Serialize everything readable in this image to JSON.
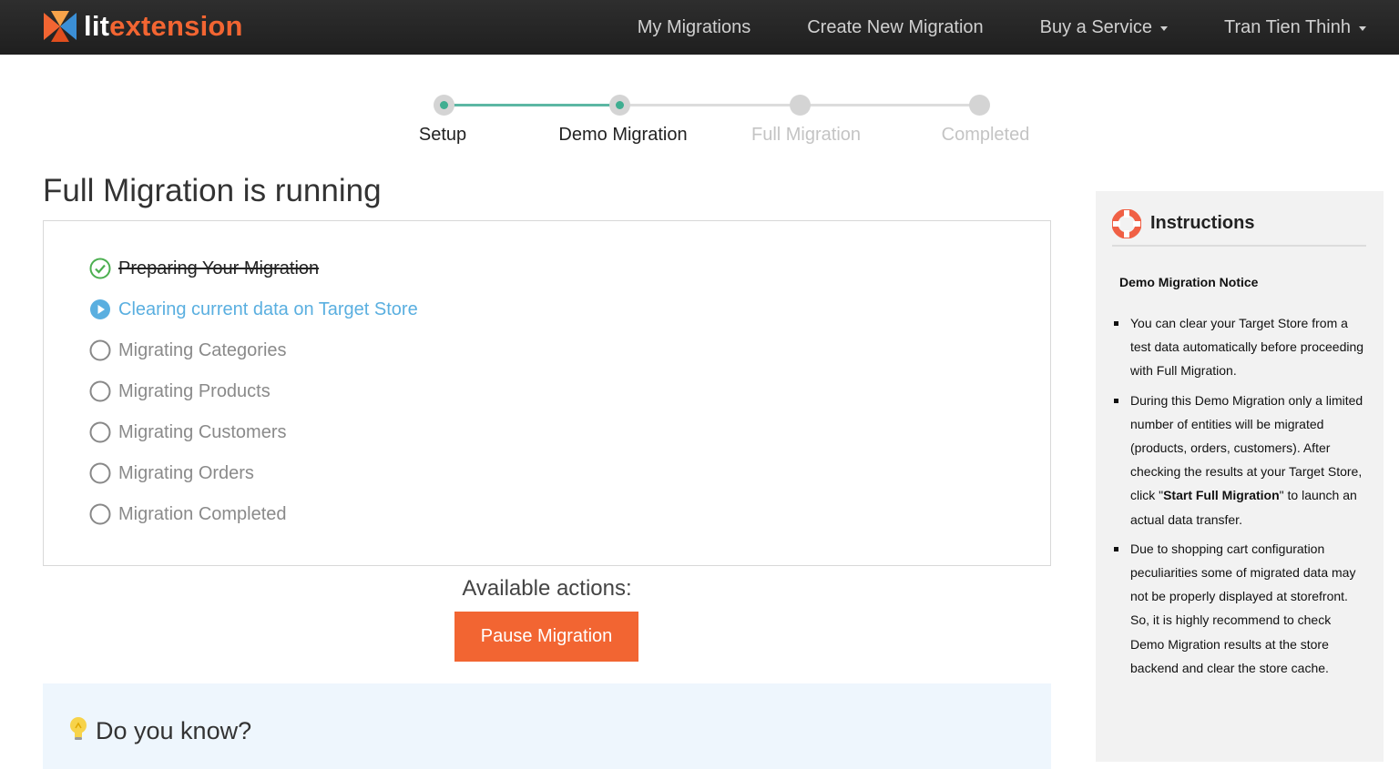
{
  "brand": {
    "lit": "lit",
    "ext": "extension"
  },
  "nav": {
    "items": [
      {
        "label": "My Migrations",
        "dropdown": false
      },
      {
        "label": "Create New Migration",
        "dropdown": false
      },
      {
        "label": "Buy a Service",
        "dropdown": true
      },
      {
        "label": "Tran Tien Thinh",
        "dropdown": true
      }
    ]
  },
  "stepper": {
    "steps": [
      {
        "label": "Setup",
        "state": "done"
      },
      {
        "label": "Demo Migration",
        "state": "done"
      },
      {
        "label": "Full Migration",
        "state": "todo"
      },
      {
        "label": "Completed",
        "state": "todo"
      }
    ]
  },
  "main": {
    "title": "Full Migration is running",
    "tasks": [
      {
        "label": "Preparing Your Migration",
        "state": "done"
      },
      {
        "label": "Clearing current data on Target Store",
        "state": "current"
      },
      {
        "label": "Migrating Categories",
        "state": "pending"
      },
      {
        "label": "Migrating Products",
        "state": "pending"
      },
      {
        "label": "Migrating Customers",
        "state": "pending"
      },
      {
        "label": "Migrating Orders",
        "state": "pending"
      },
      {
        "label": "Migration Completed",
        "state": "pending"
      }
    ],
    "actions_label": "Available actions:",
    "pause_label": "Pause Migration",
    "know_title": "Do you know?"
  },
  "sidebar": {
    "title": "Instructions",
    "notice": "Demo Migration Notice",
    "item1": "You can clear your Target Store from a test data automatically before proceeding with Full Migration.",
    "item2_a": "During this Demo Migration only a limited number of entities will be migrated (products, orders, customers). After checking the results at your Target Store, click \"",
    "item2_b": "Start Full Migration",
    "item2_c": "\" to launch an actual data transfer.",
    "item3": "Due to shopping cart configuration peculiarities some of migrated data may not be properly displayed at storefront. So, it is highly recommend to check Demo Migration results at the store backend and clear the store cache."
  },
  "colors": {
    "accent": "#f26532",
    "step_done": "#3fae91",
    "current_task": "#5aafe0",
    "check": "#4caf50"
  }
}
